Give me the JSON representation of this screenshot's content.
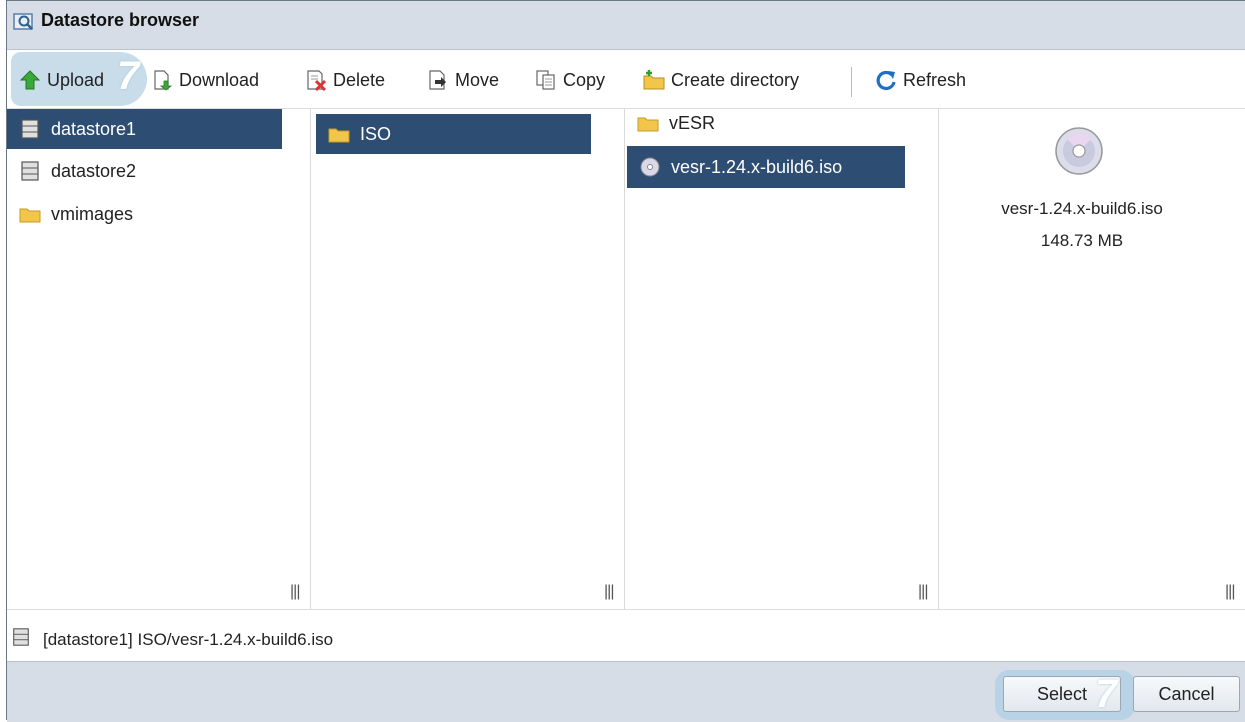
{
  "window": {
    "title": "Datastore browser"
  },
  "toolbar": {
    "upload": "Upload",
    "download": "Download",
    "delete": "Delete",
    "move": "Move",
    "copy": "Copy",
    "create_directory": "Create directory",
    "refresh": "Refresh"
  },
  "badges": {
    "upload_step": "7",
    "select_step": "7"
  },
  "columns": {
    "datastores": [
      "datastore1",
      "datastore2",
      "vmimages"
    ],
    "level1": [
      "ISO"
    ],
    "level2": [
      "vESR",
      "vesr-1.24.x-build6.iso"
    ],
    "grip": "|||"
  },
  "preview": {
    "name": "vesr-1.24.x-build6.iso",
    "size": "148.73 MB"
  },
  "path": {
    "text": "[datastore1] ISO/vesr-1.24.x-build6.iso"
  },
  "footer": {
    "select": "Select",
    "cancel": "Cancel"
  },
  "colors": {
    "selection": "#2d4d73",
    "titlebar": "#d6dde6",
    "highlight": "#c8dcea"
  }
}
